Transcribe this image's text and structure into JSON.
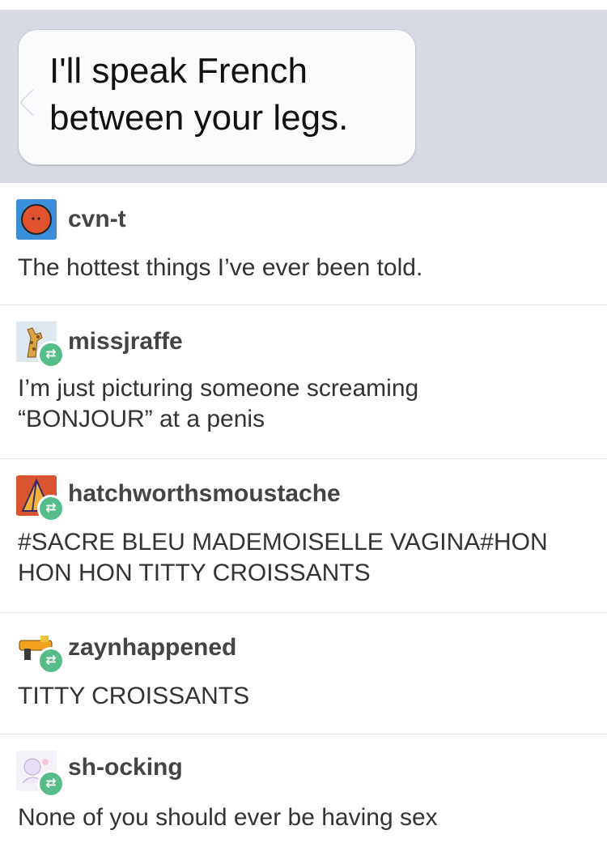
{
  "message": {
    "text_line1": "I'll speak French",
    "text_line2": "between your legs."
  },
  "posts": [
    {
      "username": "cvn-t",
      "text_line1": "The hottest things I’ve ever been told.",
      "text_line2": "",
      "avatar_icon": "orange-circle-icon",
      "reblog": false
    },
    {
      "username": "missjraffe",
      "text_line1": "I’m just picturing someone screaming",
      "text_line2": "“BONJOUR” at a penis",
      "avatar_icon": "giraffe-icon",
      "reblog": true
    },
    {
      "username": "hatchworthsmoustache",
      "text_line1": "#SACRE BLEU MADEMOISELLE VAGINA#HON",
      "text_line2": "HON HON TITTY CROISSANTS",
      "avatar_icon": "pyramid-icon",
      "reblog": true
    },
    {
      "username": "zaynhappened",
      "text_line1": "TITTY CROISSANTS",
      "text_line2": "",
      "avatar_icon": "nerf-gun-icon",
      "reblog": true
    },
    {
      "username": "sh-ocking",
      "text_line1": "None of you should ever be having sex",
      "text_line2": "",
      "avatar_icon": "anime-sketch-icon",
      "reblog": true
    }
  ],
  "colors": {
    "message_bg": "#d7dae2",
    "reblog_badge": "#56bc8a"
  }
}
